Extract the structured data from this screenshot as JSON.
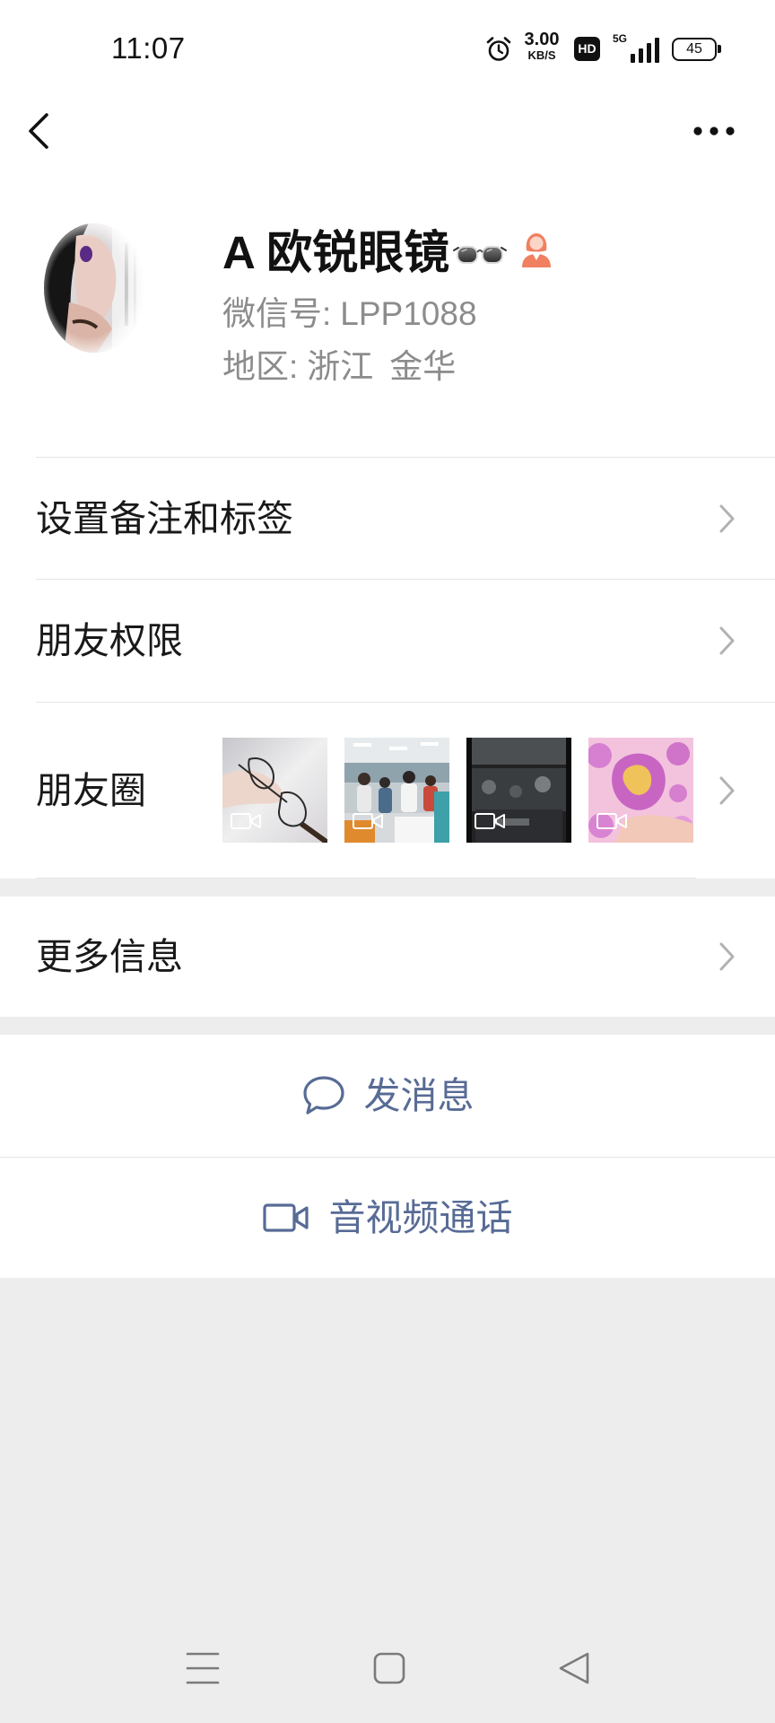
{
  "status_bar": {
    "time": "11:07",
    "alarm_icon": "alarm-icon",
    "net_speed": "3.00",
    "net_unit": "KB/S",
    "hd": "HD",
    "network": "5G",
    "signal_icon": "signal-icon",
    "battery": "45"
  },
  "header": {
    "back_icon": "chevron-left-icon",
    "more_icon": "more-dots-icon"
  },
  "profile": {
    "avatar_icon": "avatar-photo",
    "name": "A 欧锐眼镜",
    "name_emoji_icon": "eyeglasses-icon",
    "gender_icon": "female-icon",
    "wechat_id_label": "微信号:",
    "wechat_id": "LPP1088",
    "region_label": "地区:",
    "region_province": "浙江",
    "region_city": "金华"
  },
  "menu": {
    "remarks_label": "设置备注和标签",
    "permissions_label": "朋友权限",
    "moments_label": "朋友圈",
    "moments_thumbnails": [
      {
        "icon": "video-icon"
      },
      {
        "icon": "video-icon"
      },
      {
        "icon": "video-icon"
      },
      {
        "icon": "video-icon"
      }
    ],
    "more_info_label": "更多信息",
    "chevron_icon": "chevron-right-icon"
  },
  "actions": {
    "message_label": "发消息",
    "message_icon": "chat-bubble-icon",
    "call_label": "音视频通话",
    "call_icon": "video-camera-icon"
  },
  "nav_bar": {
    "icons": [
      "menu-icon",
      "home-square-icon",
      "back-triangle-icon"
    ]
  },
  "colors": {
    "link": "#576b95",
    "gender_icon": "#f08060",
    "secondary_text": "#8c8c8c",
    "page_background": "#ededed"
  }
}
